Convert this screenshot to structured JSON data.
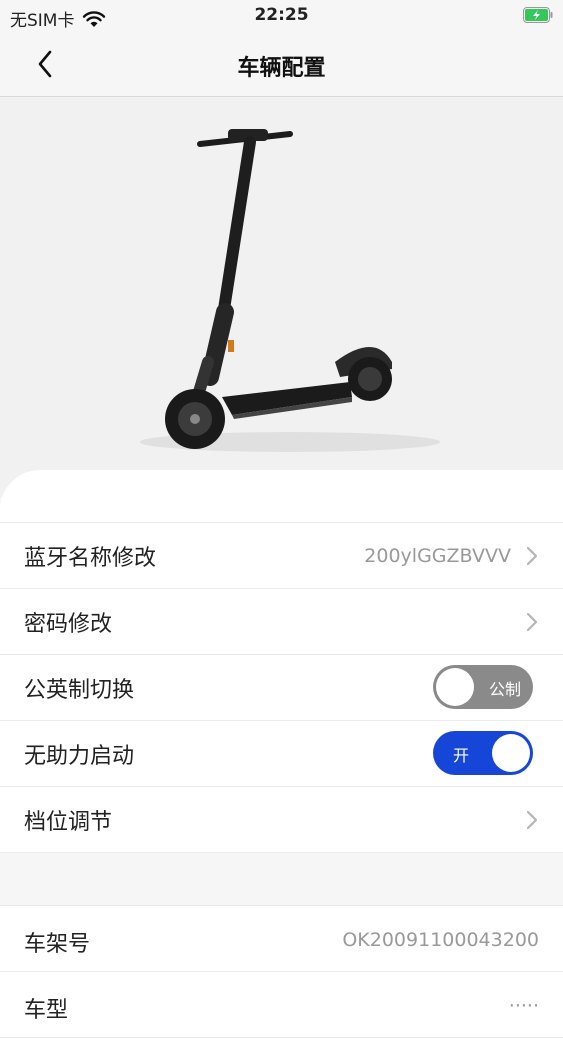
{
  "status_bar": {
    "carrier": "无SIM卡",
    "time": "22:25"
  },
  "nav": {
    "title": "车辆配置"
  },
  "settings": [
    {
      "label": "蓝牙名称修改",
      "value": "200ylGGZBVVV"
    },
    {
      "label": "密码修改",
      "value": ""
    },
    {
      "label": "公英制切换",
      "toggle_label": "公制",
      "toggle_on": false
    },
    {
      "label": "无助力启动",
      "toggle_label": "开",
      "toggle_on": true
    },
    {
      "label": "档位调节",
      "value": ""
    }
  ],
  "info": [
    {
      "label": "车架号",
      "value": "OK20091100043200"
    },
    {
      "label": "车型",
      "value": "·····"
    }
  ],
  "colors": {
    "accent": "#1546d8",
    "toggle_off": "#8a8a8a"
  }
}
